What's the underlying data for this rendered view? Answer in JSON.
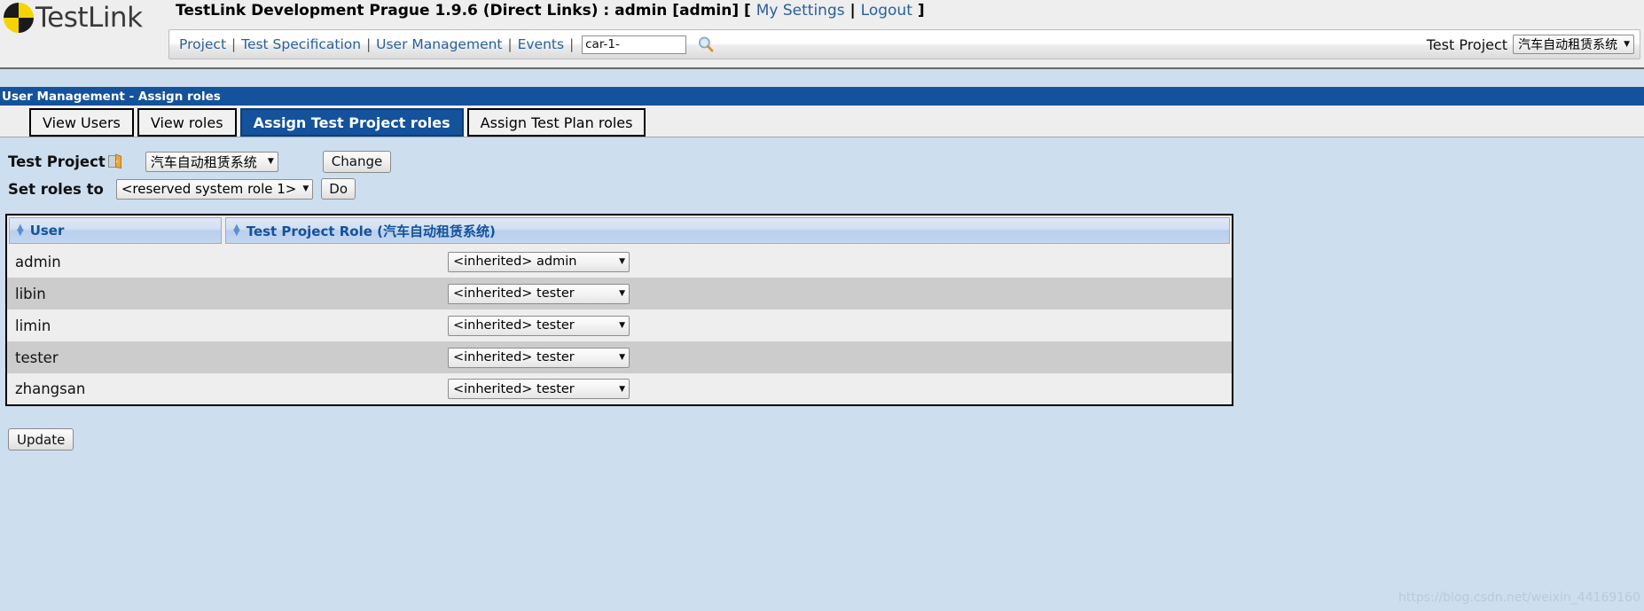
{
  "header": {
    "logo_text": "TestLink",
    "logo_icon": "testlink-pie-logo",
    "title": "TestLink Development Prague 1.9.6 (Direct Links) : admin [admin] [",
    "my_settings": "My Settings",
    "pipe": "|",
    "logout": "Logout",
    "title_close": "]",
    "nav": {
      "items": [
        {
          "label": "Project"
        },
        {
          "label": "Test Specification"
        },
        {
          "label": "User Management"
        },
        {
          "label": "Events"
        }
      ],
      "separator": "|",
      "search_value": "car-1-",
      "search_placeholder": "",
      "search_icon": "magnifier-icon"
    },
    "test_project_label": "Test Project",
    "test_project_value": "汽车自动租赁系统",
    "dropdown_arrow": "▼"
  },
  "section": {
    "title": "User Management - Assign roles"
  },
  "tabs": [
    {
      "label": "View Users",
      "active": false
    },
    {
      "label": "View roles",
      "active": false
    },
    {
      "label": "Assign Test Project roles",
      "active": true
    },
    {
      "label": "Assign Test Plan roles",
      "active": false
    }
  ],
  "controls": {
    "test_project_label": "Test Project",
    "test_project_icon": "open-door-icon",
    "test_project_value": "汽车自动租赁系统",
    "change_button": "Change",
    "set_roles_label": "Set roles to",
    "set_roles_value": "<reserved system role 1>",
    "do_button": "Do",
    "dropdown_arrow": "▼"
  },
  "table": {
    "columns": [
      {
        "label": "User",
        "sort_icon": "sort-arrows-icon"
      },
      {
        "label": "Test Project Role (汽车自动租赁系统)",
        "sort_icon": "sort-arrows-icon"
      }
    ],
    "rows": [
      {
        "user": "admin",
        "role": "<inherited> admin"
      },
      {
        "user": "libin",
        "role": "<inherited> tester"
      },
      {
        "user": "limin",
        "role": "<inherited> tester"
      },
      {
        "user": "tester",
        "role": "<inherited> tester"
      },
      {
        "user": "zhangsan",
        "role": "<inherited> tester"
      }
    ]
  },
  "footer": {
    "update_button": "Update",
    "watermark": "https://blog.csdn.net/weixin_44169160"
  },
  "colors": {
    "accent_blue": "#14529b",
    "page_background": "#cddeef",
    "link_blue": "#2a6099",
    "row_odd": "#eeeeee",
    "row_even": "#cccccc"
  }
}
